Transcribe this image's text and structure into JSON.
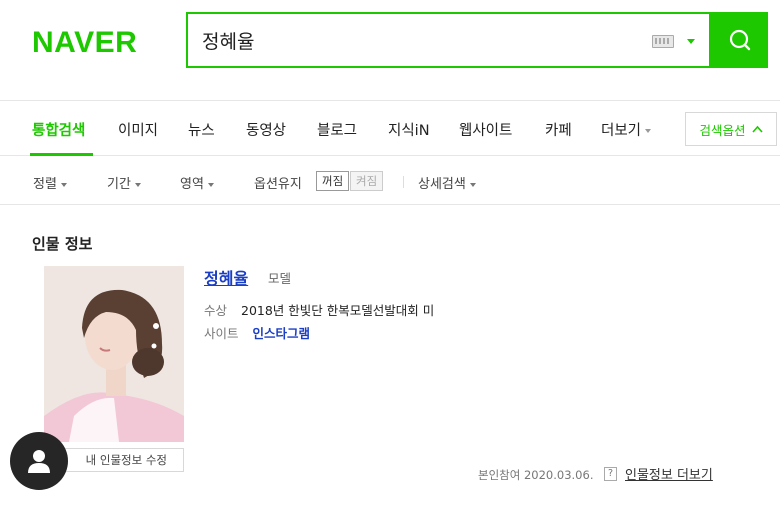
{
  "header": {
    "logo_text": "NAVER",
    "search_value": "정혜율",
    "brand_color": "#1ec800",
    "icons": [
      "keyboard-icon",
      "dropdown-arrow-icon",
      "search-icon"
    ]
  },
  "tabs": [
    {
      "label": "통합검색",
      "active": true
    },
    {
      "label": "이미지"
    },
    {
      "label": "뉴스"
    },
    {
      "label": "동영상"
    },
    {
      "label": "블로그"
    },
    {
      "label": "지식iN"
    },
    {
      "label": "웹사이트"
    },
    {
      "label": "카페"
    },
    {
      "label": "더보기"
    }
  ],
  "search_options_label": "검색옵션",
  "filters": {
    "sort": "정렬",
    "period": "기간",
    "area": "영역",
    "keep_option": "옵션유지",
    "toggle_off": "꺼짐",
    "toggle_on": "켜짐",
    "detail_search": "상세검색"
  },
  "person": {
    "section_title": "인물 정보",
    "name": "정혜율",
    "role": "모델",
    "award_label": "수상",
    "award_value": "2018년 한빛단 한복모델선발대회 미",
    "site_label": "사이트",
    "site_value": "인스타그램",
    "edit_button": "내 인물정보 수정",
    "verified_note": "본인참여 2020.03.06.",
    "help_icon": "?",
    "more_link": "인물정보 더보기"
  }
}
